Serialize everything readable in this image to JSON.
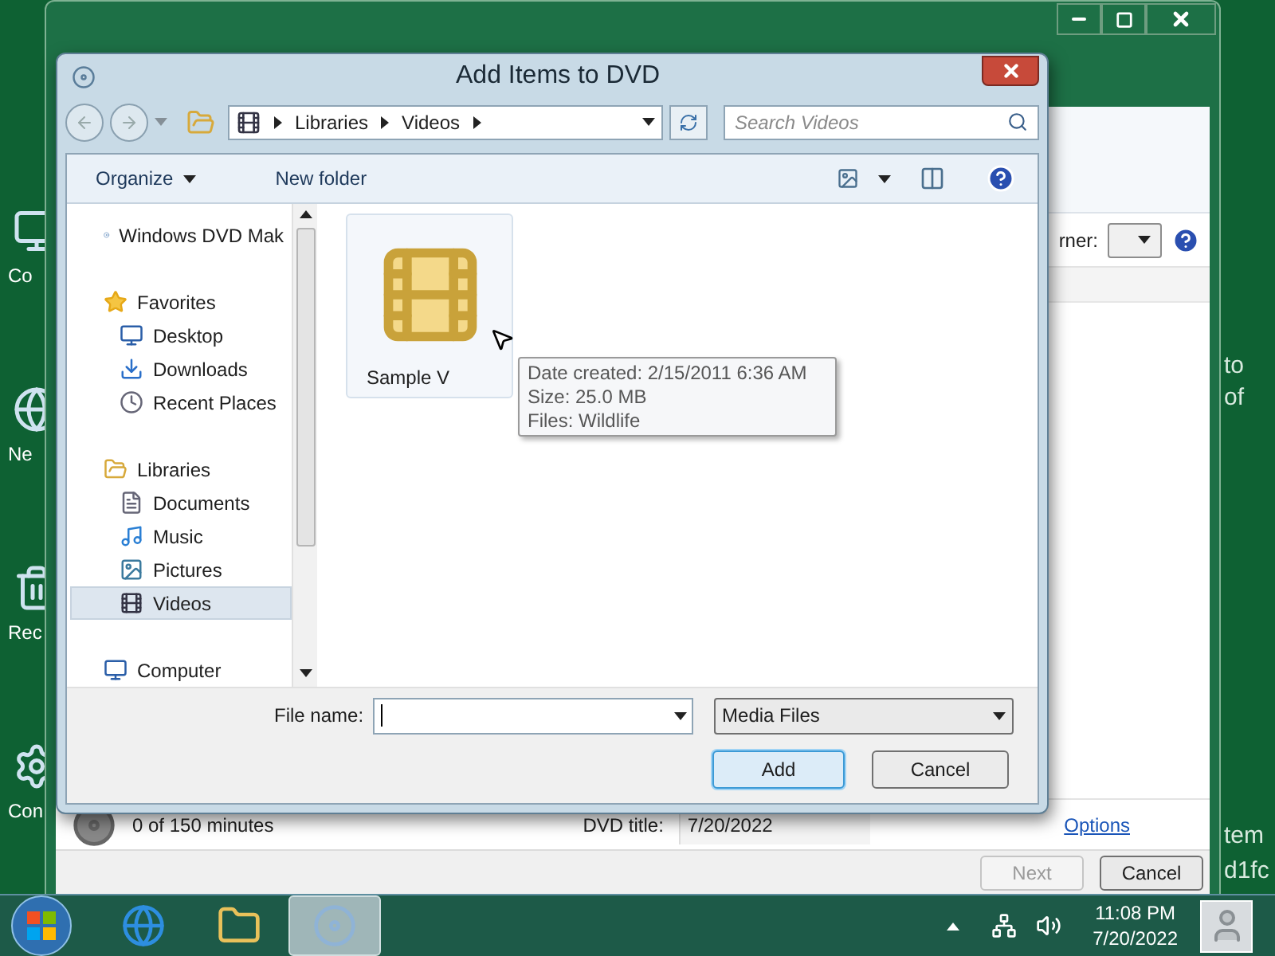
{
  "desktop_icons": [
    {
      "label": "Co"
    },
    {
      "label": "Ne"
    },
    {
      "label": "Rec"
    },
    {
      "label": "Con"
    }
  ],
  "background_text": [
    "to",
    "of",
    "tem",
    "d1fc"
  ],
  "dvd_maker": {
    "owner_label": "rner:",
    "capacity": "0 of 150 minutes",
    "dvd_title_label": "DVD title:",
    "dvd_title_value": "7/20/2022",
    "options_link": "Options",
    "buttons": [
      {
        "label": "Next",
        "disabled": true
      },
      {
        "label": "Cancel",
        "disabled": false
      }
    ]
  },
  "dialog": {
    "title": "Add Items to DVD",
    "breadcrumb": [
      "Libraries",
      "Videos"
    ],
    "search_placeholder": "Search Videos",
    "toolbar": [
      {
        "label": "Organize",
        "has_menu": true
      },
      {
        "label": "New folder",
        "has_menu": false
      }
    ],
    "nav": [
      {
        "label": "Windows DVD Mak",
        "kind": "dvd",
        "selected": false
      },
      {
        "label": "Favorites",
        "kind": "star",
        "selected": false,
        "children": [
          {
            "label": "Desktop",
            "kind": "desktop",
            "selected": false
          },
          {
            "label": "Downloads",
            "kind": "downloads",
            "selected": false
          },
          {
            "label": "Recent Places",
            "kind": "recent",
            "selected": false
          }
        ]
      },
      {
        "label": "Libraries",
        "kind": "library",
        "selected": false,
        "children": [
          {
            "label": "Documents",
            "kind": "documents",
            "selected": false
          },
          {
            "label": "Music",
            "kind": "music",
            "selected": false
          },
          {
            "label": "Pictures",
            "kind": "pictures",
            "selected": false
          },
          {
            "label": "Videos",
            "kind": "videos",
            "selected": true
          }
        ]
      },
      {
        "label": "Computer",
        "kind": "computer",
        "selected": false
      }
    ],
    "files": [
      {
        "name": "Sample V",
        "selected": false
      }
    ],
    "tooltip": [
      "Date created: 2/15/2011 6:36 AM",
      "Size: 25.0 MB",
      "Files: Wildlife"
    ],
    "file_name_label": "File name:",
    "filter": "Media Files",
    "buttons": [
      {
        "label": "Add",
        "default": true
      },
      {
        "label": "Cancel",
        "default": false
      }
    ]
  },
  "taskbar": {
    "items": [
      {
        "kind": "browser",
        "selected": false
      },
      {
        "kind": "folder",
        "selected": false
      },
      {
        "kind": "dvd",
        "selected": true
      }
    ],
    "time": "11:08 PM",
    "date": "7/20/2022"
  }
}
